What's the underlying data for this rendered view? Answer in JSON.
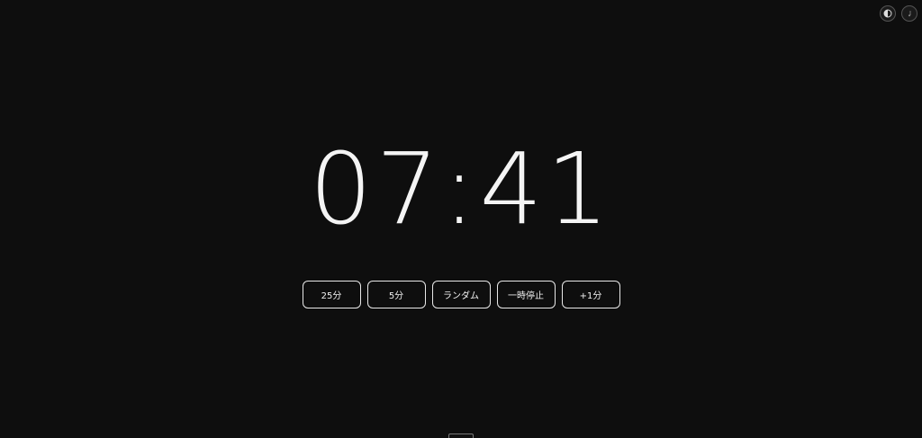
{
  "timer": {
    "display": "07:41"
  },
  "controls": {
    "buttons": [
      {
        "label": "25分"
      },
      {
        "label": "5分"
      },
      {
        "label": "ランダム"
      },
      {
        "label": "一時停止"
      },
      {
        "label": "+1分"
      }
    ]
  },
  "toolbar": {
    "icons": [
      "theme-contrast-icon",
      "sound-icon"
    ]
  },
  "colors": {
    "background": "#0e0e0e",
    "foreground": "#f4f4f4",
    "button_border": "#e8e8e8"
  }
}
